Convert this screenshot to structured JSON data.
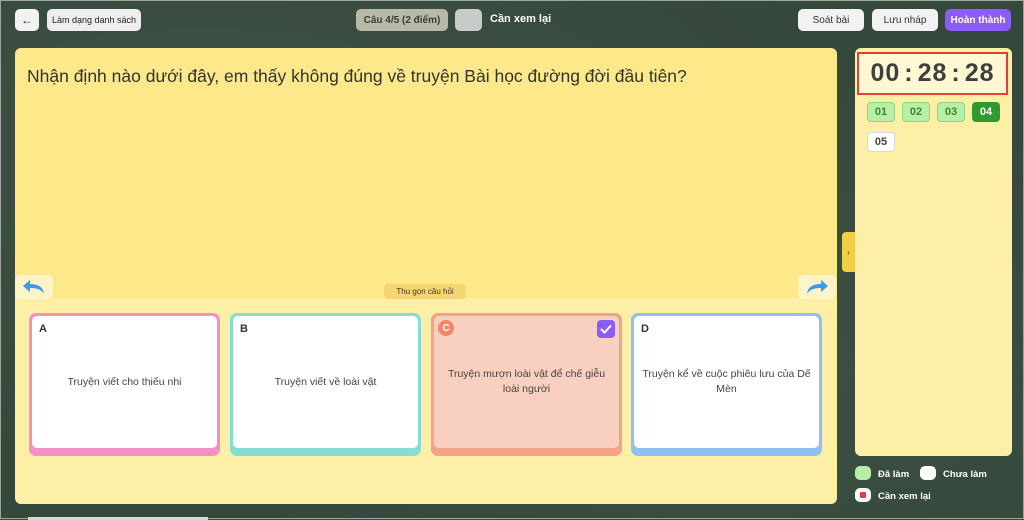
{
  "header": {
    "back_icon": "←",
    "list_mode_label": "Làm dạng danh sách",
    "question_counter": "Câu 4/5 (2 điểm)",
    "review_label": "Cần xem lại",
    "check_label": "Soát bài",
    "draft_label": "Lưu nháp",
    "finish_label": "Hoàn thành"
  },
  "question": {
    "text": "Nhận định nào dưới đây, em thấy không đúng về truyện Bài học đường đời đầu tiên?",
    "collapse_label": "Thu gọn câu hỏi",
    "prev_icon": "undo-arrow-icon",
    "next_icon": "redo-arrow-icon"
  },
  "answers": [
    {
      "letter": "A",
      "text": "Truyện viết cho thiếu nhi",
      "selected": false,
      "color": "#f58fc8"
    },
    {
      "letter": "B",
      "text": "Truyện viết về loài vật",
      "selected": false,
      "color": "#86ddd6"
    },
    {
      "letter": "C",
      "text": "Truyện mượn loài vật để chế giễu loài người",
      "selected": true,
      "color": "#f2a388"
    },
    {
      "letter": "D",
      "text": "Truyện kể về cuộc phiêu lưu của Dế Mèn",
      "selected": false,
      "color": "#8ec1ef"
    }
  ],
  "sidebar": {
    "toggle_icon": "›",
    "timer": {
      "h": "00",
      "m": "28",
      "s": "28",
      "sep": ":"
    },
    "questions": [
      {
        "label": "01",
        "state": "done"
      },
      {
        "label": "02",
        "state": "done"
      },
      {
        "label": "03",
        "state": "done"
      },
      {
        "label": "04",
        "state": "current"
      },
      {
        "label": "05",
        "state": "todo"
      }
    ]
  },
  "legend": {
    "done_label": "Đã làm",
    "todo_label": "Chưa làm",
    "review_label": "Cần xem lại",
    "done_color": "#b9eea6",
    "todo_color": "#ffffff",
    "review_color": "#e0403a"
  },
  "colors": {
    "accent": "#8b5cf6",
    "current_question": "#2f9a2f",
    "panel": "#fde98a"
  }
}
